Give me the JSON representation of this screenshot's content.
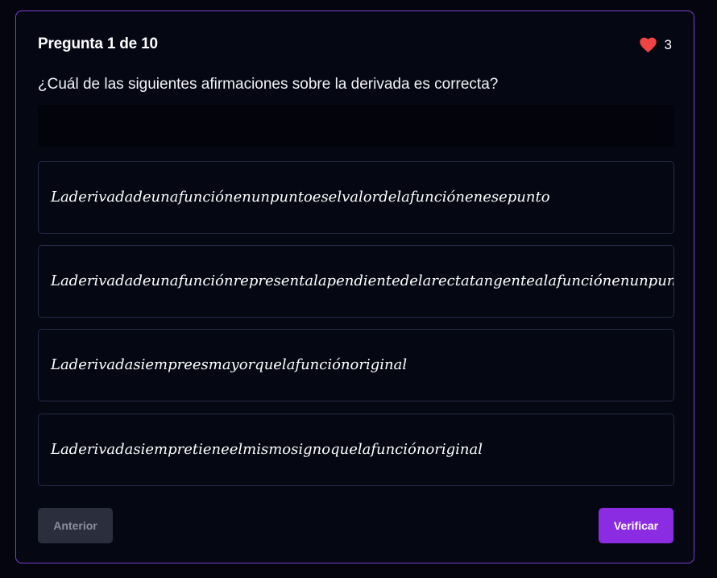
{
  "header": {
    "counter": "Pregunta 1 de 10",
    "lives": "3",
    "heart_icon": "heart-icon",
    "heart_color": "#ef4444"
  },
  "question": {
    "text": "¿Cuál de las siguientes afirmaciones sobre la derivada es correcta?"
  },
  "options": [
    {
      "label": "Laderivadadeunafunciónenunpuntoeselvalordelafunciónenesepunto"
    },
    {
      "label": "Laderivadadeunafunciónrepresentalapendientedelarectatangentealafunciónenunpunto"
    },
    {
      "label": "Laderivadasiempreesmayorquelafunciónoriginal"
    },
    {
      "label": "Laderivadasiempretieneelmismosignoquelafunciónoriginal"
    }
  ],
  "footer": {
    "prev_label": "Anterior",
    "verify_label": "Verificar",
    "accent_color": "#8b2be2",
    "border_color": "#7b3fd0"
  }
}
